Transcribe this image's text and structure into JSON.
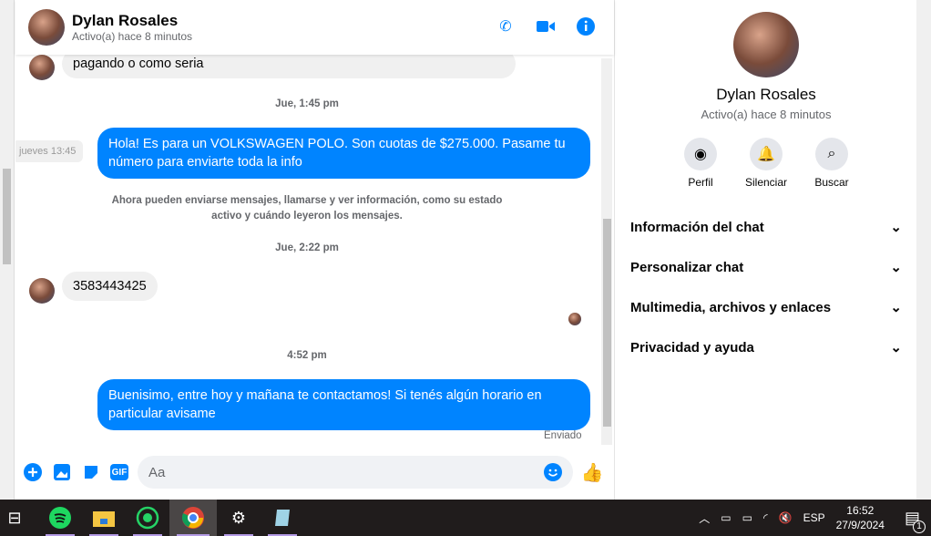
{
  "contact": {
    "name": "Dylan Rosales",
    "status": "Activo(a) hace 8 minutos"
  },
  "messages": {
    "partial_in": "pagando o como seria",
    "ts1": "Jue, 1:45 pm",
    "tooltip": "jueves 13:45",
    "out1": "Hola! Es para un VOLKSWAGEN POLO. Son cuotas de $275.000. Pasame tu número para enviarte toda la info",
    "system": "Ahora pueden enviarse mensajes, llamarse y ver información, como su estado activo y cuándo leyeron los mensajes.",
    "ts2": "Jue, 2:22 pm",
    "in2": "3583443425",
    "ts3": "4:52 pm",
    "out2": "Buenisimo, entre hoy y mañana te contactamos! Si tenés algún horario en particular avisame",
    "sent": "Enviado"
  },
  "composer": {
    "placeholder": "Aa",
    "gif": "GIF"
  },
  "panel": {
    "actions": [
      {
        "label": "Perfil"
      },
      {
        "label": "Silenciar"
      },
      {
        "label": "Buscar"
      }
    ],
    "sections": [
      "Información del chat",
      "Personalizar chat",
      "Multimedia, archivos y enlaces",
      "Privacidad y ayuda"
    ]
  },
  "taskbar": {
    "lang": "ESP",
    "time": "16:52",
    "date": "27/9/2024",
    "notifications": "1"
  }
}
